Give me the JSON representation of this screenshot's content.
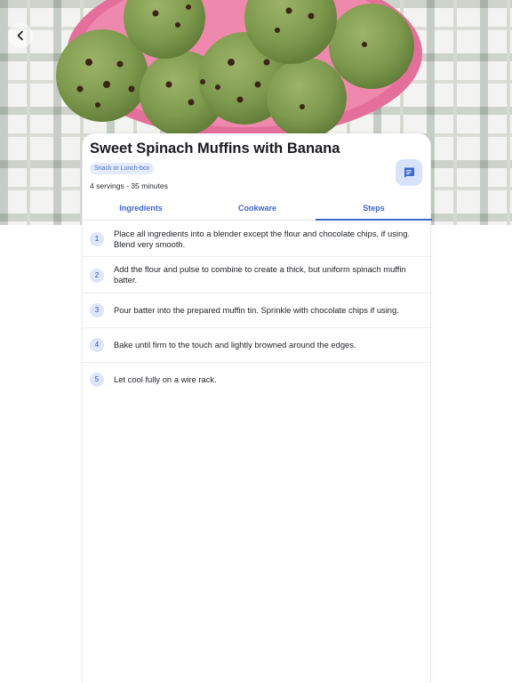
{
  "recipe": {
    "title": "Sweet Spinach Muffins with Banana",
    "tag": "Snack or Lunch-box",
    "meta": "4 servings - 35 minutes"
  },
  "hero": {
    "alt": "spinach muffins on a pink plate"
  },
  "icons": {
    "back": "chevron-left-icon",
    "fab": "notes-list-icon"
  },
  "tabs": [
    {
      "label": "Ingredients",
      "active": false
    },
    {
      "label": "Cookware",
      "active": false
    },
    {
      "label": "Steps",
      "active": true
    }
  ],
  "steps": [
    {
      "number": "1",
      "text": "Place all ingredients into a blender except the flour and chocolate chips, if using. Blend very smooth."
    },
    {
      "number": "2",
      "text": "Add the flour and pulse to combine to create a thick, but uniform spinach muffin batter."
    },
    {
      "number": "3",
      "text": "Pour batter into the prepared muffin tin. Sprinkle with chocolate chips if using."
    },
    {
      "number": "4",
      "text": "Bake until firm to the touch and lightly browned around the edges."
    },
    {
      "number": "5",
      "text": "Let cool fully on a wire rack."
    }
  ],
  "colors": {
    "accent": "#3c67d0",
    "plate": "#ec7aa4",
    "muffin": "#7e9a4e"
  }
}
